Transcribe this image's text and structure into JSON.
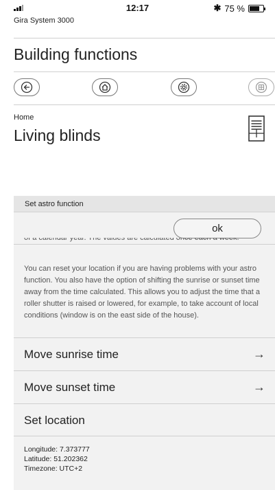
{
  "status_bar": {
    "time": "12:17",
    "battery_text": "75 %",
    "battery_level": 0.75,
    "icons": [
      "signal-icon",
      "bluetooth-icon",
      "battery-icon"
    ]
  },
  "app": {
    "name": "Gira System 3000",
    "section_title": "Building functions"
  },
  "nav": {
    "buttons": [
      "back-arrow-icon",
      "home-icon",
      "settings-gear-icon",
      "grid-icon"
    ]
  },
  "page": {
    "breadcrumb": "Home",
    "title": "Living blinds",
    "device_icon": "blind-icon"
  },
  "dialog": {
    "header": "Set astro function",
    "ok_label": "ok",
    "clipped_text": "of a calendar year. The values are calculated once each a week.",
    "description": "You can reset your location if you are having problems with your astro function. You also have the option of shifting the sunrise or sunset time away from the time calculated. This allows you to adjust the time that a roller shutter is raised or lowered, for example, to take account of local conditions (window is on the east side of the house).",
    "rows": [
      {
        "label": "Move sunrise time",
        "arrow": "→"
      },
      {
        "label": "Move sunset time",
        "arrow": "→"
      },
      {
        "label": "Set location"
      }
    ],
    "location": {
      "longitude": "Longitude: 7.373777",
      "latitude": "Latitude: 51.202362",
      "timezone": "Timezone: UTC+2"
    }
  }
}
